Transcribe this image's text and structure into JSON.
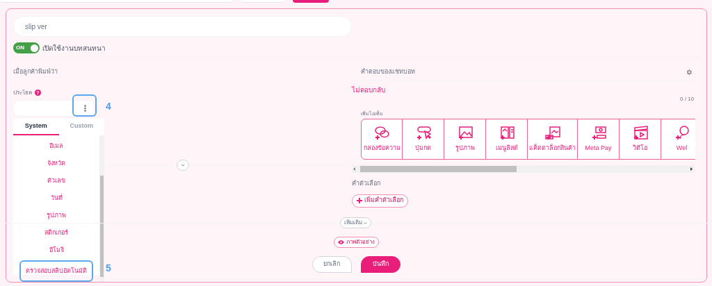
{
  "name_field": {
    "value": "slip ver"
  },
  "toggle": {
    "on": true,
    "text": "ON",
    "label": "เปิดใช้งานบทสนทนา"
  },
  "left": {
    "heading": "เมื่อลูกค้าพิมพ์ว่า",
    "sentence_label": "ประโยค",
    "help": "?",
    "menu": {
      "tabs": [
        {
          "label": "System",
          "selected": true
        },
        {
          "label": "Custom",
          "selected": false
        }
      ],
      "items": [
        {
          "label": "อีเมล",
          "highlighted": false
        },
        {
          "label": "จังหวัด",
          "highlighted": false
        },
        {
          "label": "ตัวเลข",
          "highlighted": false
        },
        {
          "label": "วันที่",
          "highlighted": false
        },
        {
          "label": "รูปภาพ",
          "highlighted": false
        },
        {
          "label": "สติกเกอร์",
          "highlighted": false
        },
        {
          "label": "อีโมจิ",
          "highlighted": false
        },
        {
          "label": "ตรวจสอบสลิปอัตโนมัติ",
          "highlighted": true
        }
      ]
    },
    "annotations": [
      {
        "text": "4"
      },
      {
        "text": "5"
      }
    ]
  },
  "right": {
    "heading": "คำตอบของแชทบอท",
    "reply_mode": "ไม่ตอบกลับ",
    "counter": "0 / 10",
    "add_item_label": "เพิ่มไอเท็ม",
    "items": [
      {
        "label": "กล่องข้อความ"
      },
      {
        "label": "ปุ่มกด"
      },
      {
        "label": "รูปภาพ"
      },
      {
        "label": "เมนูลิสต์"
      },
      {
        "label": "แค็ตตาล็อกสินค้า"
      },
      {
        "label": "Meta Pay"
      },
      {
        "label": "วิดีโอ"
      },
      {
        "label": "Wel"
      }
    ],
    "options_heading": "คำตัวเลือก",
    "add_option": "เพิ่มคำตัวเลือก"
  },
  "more_button": "เพิ่มเติม",
  "preview_button": "ภาพตัวอย่าง",
  "buttons": [
    {
      "label": "ยกเลิก",
      "kind": "secondary"
    },
    {
      "label": "บันทึก",
      "kind": "primary"
    }
  ]
}
